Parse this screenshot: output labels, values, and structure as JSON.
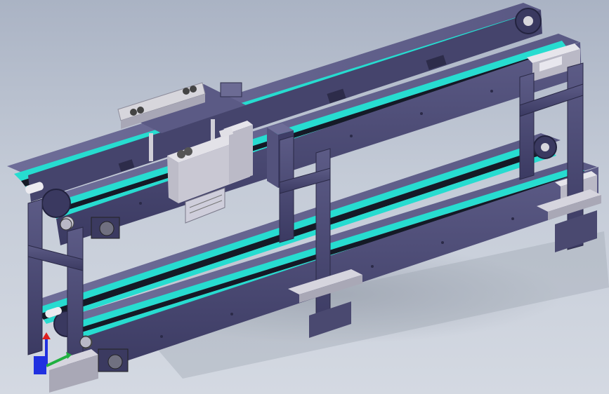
{
  "viewport": {
    "background_top": "#aab3c4",
    "background_bottom": "#d4d9e2"
  },
  "model": {
    "frame_color": "#4b4a72",
    "frame_dark": "#34345a",
    "frame_light": "#66658f",
    "belt_color": "#27dcd0",
    "belt_dark": "#121722",
    "block_color": "#d7d6dc",
    "block_dark": "#9c9baa"
  },
  "triad": {
    "x_axis_color": "#e02020",
    "y_axis_color": "#20b040",
    "z_axis_color": "#2030e0",
    "icon": "coordinate-triad-icon"
  }
}
